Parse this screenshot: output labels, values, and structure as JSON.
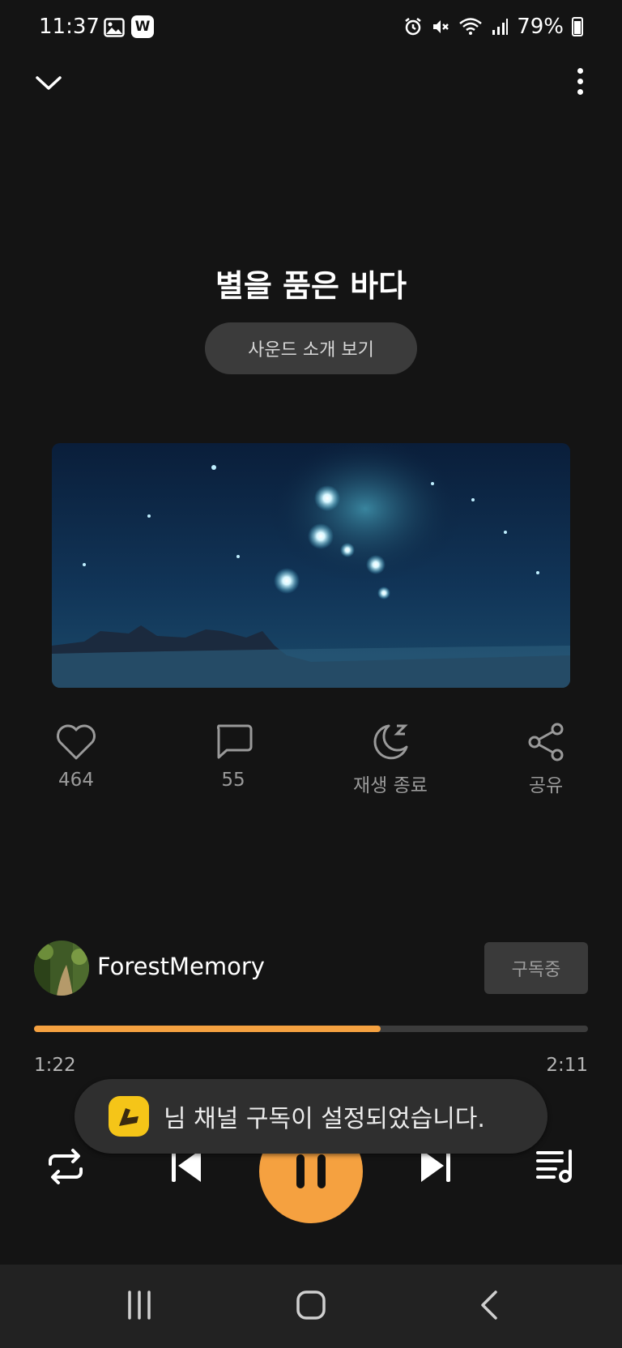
{
  "status_bar": {
    "time": "11:37",
    "battery": "79%",
    "icons": [
      "gallery-icon",
      "w-app-icon",
      "alarm-icon",
      "mute-icon",
      "wifi-icon",
      "signal-icon",
      "battery-icon"
    ]
  },
  "player": {
    "title": "별을 품은 바다",
    "intro_button": "사운드 소개 보기",
    "actions": [
      {
        "icon": "heart-icon",
        "label": "464"
      },
      {
        "icon": "comment-icon",
        "label": "55"
      },
      {
        "icon": "sleep-timer-icon",
        "label": "재생 종료"
      },
      {
        "icon": "share-icon",
        "label": "공유"
      }
    ],
    "channel": {
      "name": "ForestMemory",
      "subscribe_label": "구독중"
    },
    "progress": {
      "current": "1:22",
      "total": "2:11",
      "fraction": 0.626
    }
  },
  "toast": {
    "text": "님 채널 구독이 설정되었습니다."
  },
  "colors": {
    "background": "#141414",
    "accent": "#f5a140",
    "button_bg": "#3b3b3b",
    "toast_bg": "#2f2f2f",
    "navbar_bg": "#222222"
  }
}
